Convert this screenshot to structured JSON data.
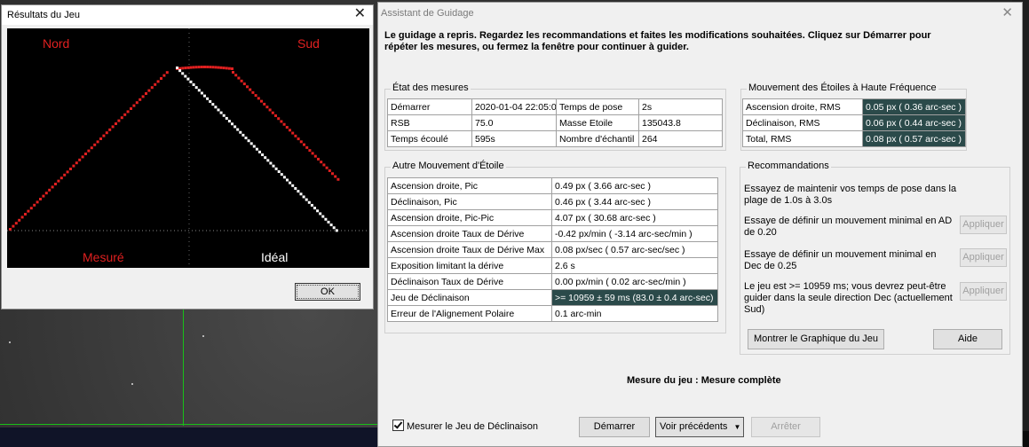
{
  "game_window": {
    "title": "Résultats du Jeu",
    "label_north": "Nord",
    "label_south": "Sud",
    "label_measured": "Mesuré",
    "label_ideal": "Idéal",
    "ok_label": "OK",
    "colors": {
      "measured": "#e02020",
      "ideal": "#ffffff",
      "plot_bg": "#000000"
    }
  },
  "guide_window": {
    "title": "Assistant de Guidage",
    "intro": "Le guidage a repris. Regardez les recommandations et faites les modifications souhaitées. Cliquez sur Démarrer pour répéter les mesures, ou fermez la fenêtre pour continuer à guider.",
    "state_group": {
      "label": "État des mesures",
      "rows": [
        [
          "Démarrer",
          "2020-01-04 22:05:06",
          "Temps de pose",
          "2s"
        ],
        [
          "RSB",
          "75.0",
          "Masse Etoile",
          "135043.8"
        ],
        [
          "Temps écoulé",
          "595s",
          "Nombre d'échantil",
          "264"
        ]
      ]
    },
    "hf_group": {
      "label": "Mouvement des Étoiles à Haute Fréquence",
      "rows": [
        [
          "Ascension droite, RMS",
          "0.05 px ( 0.36 arc-sec )"
        ],
        [
          "Déclinaison, RMS",
          "0.06 px ( 0.44 arc-sec )"
        ],
        [
          "Total, RMS",
          "0.08 px ( 0.57 arc-sec )"
        ]
      ]
    },
    "other_group": {
      "label": "Autre Mouvement d'Étoile",
      "rows": [
        [
          "Ascension droite, Pic",
          "0.49 px ( 3.66 arc-sec )"
        ],
        [
          "Déclinaison, Pic",
          "0.46 px ( 3.44 arc-sec )"
        ],
        [
          "Ascension droite, Pic-Pic",
          "4.07 px ( 30.68 arc-sec )"
        ],
        [
          "Ascension droite Taux de Dérive",
          "-0.42 px/min ( -3.14 arc-sec/min )"
        ],
        [
          "Ascension droite Taux de Dérive Max",
          "0.08 px/sec ( 0.57 arc-sec/sec )"
        ],
        [
          "Exposition limitant la dérive",
          "2.6 s"
        ],
        [
          "Déclinaison Taux de Dérive",
          "0.00 px/min ( 0.02 arc-sec/min )"
        ],
        [
          "Jeu de Déclinaison",
          ">= 10959 ± 59 ms (83.0 ± 0.4 arc-sec)"
        ],
        [
          "Erreur de l'Alignement Polaire",
          "0.1 arc-min"
        ]
      ]
    },
    "reco_group": {
      "label": "Recommandations",
      "items": [
        {
          "text": "Essayez de maintenir vos temps de pose dans la plage de 1.0s à 3.0s",
          "button": ""
        },
        {
          "text": "Essaye de définir un mouvement minimal en AD de 0.20",
          "button": "Appliquer"
        },
        {
          "text": "Essaye de définir un mouvement minimal en Dec de 0.25",
          "button": "Appliquer"
        },
        {
          "text": "Le jeu est >= 10959 ms; vous devrez peut-être guider dans la seule direction Dec (actuellement Sud)",
          "button": "Appliquer"
        }
      ],
      "show_graph_button": "Montrer le Graphique du Jeu",
      "help_button": "Aide"
    },
    "status": "Mesure du jeu : Mesure complète",
    "measure_backlash_checkbox": {
      "label": "Mesurer le Jeu de Déclinaison",
      "checked": true
    },
    "start_button": "Démarrer",
    "previous_button": "Voir précédents",
    "stop_button": "Arrêter"
  }
}
